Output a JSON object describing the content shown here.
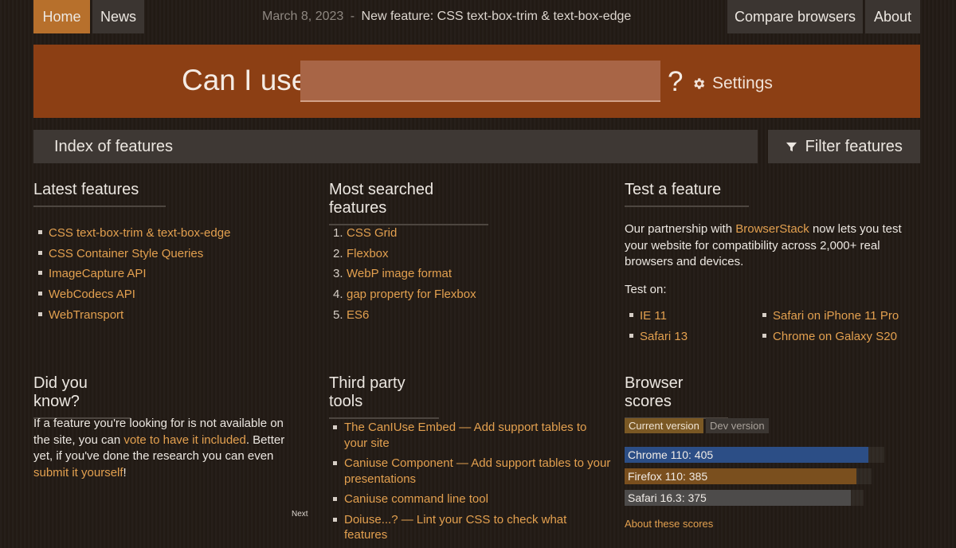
{
  "nav": {
    "home": "Home",
    "news": "News",
    "compare": "Compare browsers",
    "about": "About"
  },
  "announcement": {
    "date": "March 8, 2023",
    "separator": "-",
    "title": "New feature: CSS text-box-trim & text-box-edge"
  },
  "search": {
    "prefix": "Can I use",
    "value": "",
    "suffix": "?",
    "settings_label": "Settings"
  },
  "index_bar": {
    "label": "Index of features",
    "filter_label": "Filter features"
  },
  "latest": {
    "heading": "Latest features",
    "items": [
      "CSS text-box-trim & text-box-edge",
      "CSS Container Style Queries",
      "ImageCapture API",
      "WebCodecs API",
      "WebTransport"
    ]
  },
  "most_searched": {
    "heading": "Most searched features",
    "items": [
      {
        "num": "1.",
        "label": "CSS Grid"
      },
      {
        "num": "2.",
        "label": "Flexbox"
      },
      {
        "num": "3.",
        "label": "WebP image format"
      },
      {
        "num": "4.",
        "label": "gap property for Flexbox"
      },
      {
        "num": "5.",
        "label": "ES6"
      }
    ]
  },
  "test_feature": {
    "heading": "Test a feature",
    "intro_1": "Our partnership with",
    "intro_link": "BrowserStack",
    "intro_2": "now lets you test your website for compatibility across 2,000+ real browsers and devices.",
    "test_on": "Test on:",
    "left_items": [
      "IE 11",
      "Safari 13"
    ],
    "right_items": [
      "Safari on iPhone 11 Pro",
      "Chrome on Galaxy S20"
    ]
  },
  "did_you_know": {
    "heading": "Did you know?",
    "text_1": "If a feature you're looking for is not available on the site, you can",
    "link_1": "vote to have it included",
    "text_2": ". Better yet, if you've done the research you can even",
    "link_2": "submit it yourself",
    "text_3": "!",
    "next": "Next"
  },
  "third_party": {
    "heading": "Third party tools",
    "items": [
      "The CanIUse Embed — Add support tables to your site",
      "Caniuse Component — Add support tables to your presentations",
      "Caniuse command line tool",
      "Doiuse...? — Lint your CSS to check what features"
    ]
  },
  "browser_scores": {
    "heading": "Browser scores",
    "tab_current": "Current version",
    "tab_dev": "Dev version",
    "scores": [
      {
        "label": "Chrome 110: 405",
        "score": 405,
        "color": "#2c4e86"
      },
      {
        "label": "Firefox 110: 385",
        "score": 385,
        "color": "#7a4f1e"
      },
      {
        "label": "Safari 16.3: 375",
        "score": 375,
        "color": "#4d4b4a"
      }
    ],
    "max_score": 431,
    "about_link": "About these scores"
  }
}
